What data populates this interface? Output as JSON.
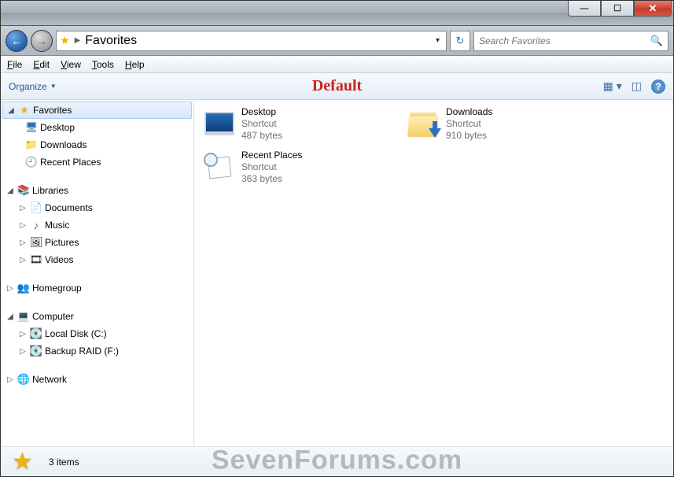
{
  "titlebar": {
    "min": "—",
    "max": "☐",
    "close": "✕"
  },
  "nav": {
    "location": "Favorites",
    "search_placeholder": "Search Favorites"
  },
  "menu": {
    "file": "File",
    "edit": "Edit",
    "view": "View",
    "tools": "Tools",
    "help": "Help"
  },
  "toolbar": {
    "organize": "Organize",
    "overlay": "Default"
  },
  "sidebar": {
    "favorites": "Favorites",
    "fav_items": [
      "Desktop",
      "Downloads",
      "Recent Places"
    ],
    "libraries": "Libraries",
    "lib_items": [
      "Documents",
      "Music",
      "Pictures",
      "Videos"
    ],
    "homegroup": "Homegroup",
    "computer": "Computer",
    "comp_items": [
      "Local Disk (C:)",
      "Backup RAID (F:)"
    ],
    "network": "Network"
  },
  "items": [
    {
      "name": "Desktop",
      "type": "Shortcut",
      "size": "487 bytes",
      "icon": "desktop"
    },
    {
      "name": "Downloads",
      "type": "Shortcut",
      "size": "910 bytes",
      "icon": "downloads"
    },
    {
      "name": "Recent Places",
      "type": "Shortcut",
      "size": "363 bytes",
      "icon": "recent"
    }
  ],
  "status": {
    "count": "3 items"
  },
  "watermark": "SevenForums.com"
}
